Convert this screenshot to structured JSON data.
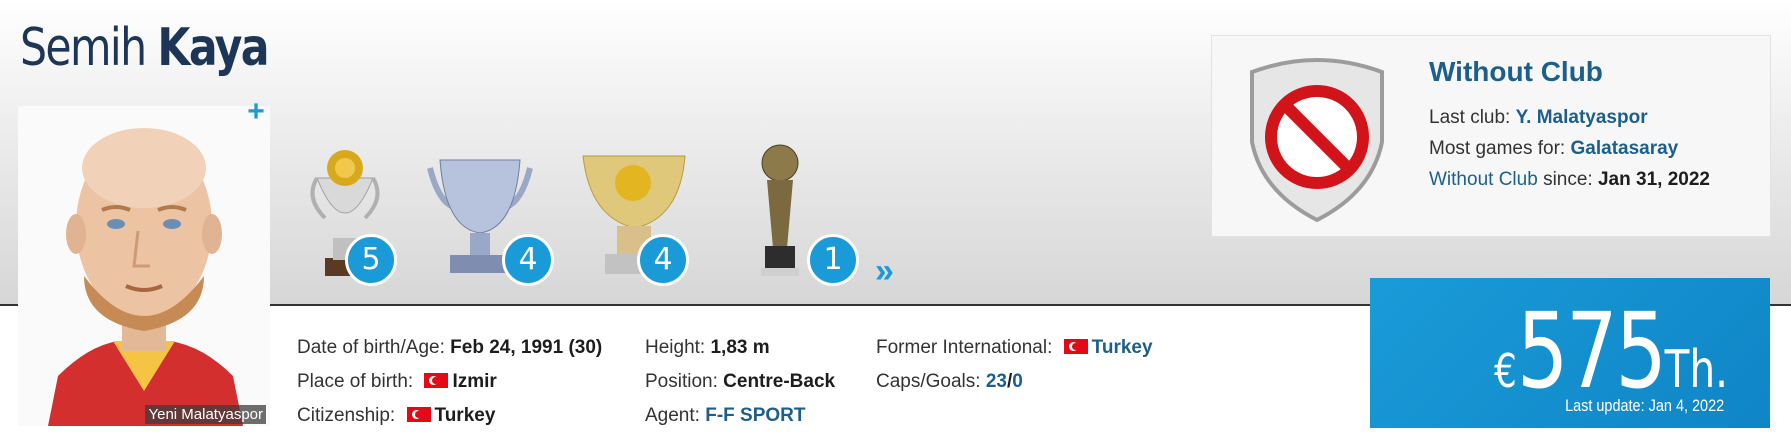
{
  "player": {
    "first_name": "Semih",
    "last_name": "Kaya",
    "photo_caption": "Yeni Malatyaspor",
    "plus_label": "+"
  },
  "trophies": [
    {
      "name": "league-trophy",
      "count": "5"
    },
    {
      "name": "cup-trophy",
      "count": "4"
    },
    {
      "name": "super-cup-trophy",
      "count": "4"
    },
    {
      "name": "ball-trophy",
      "count": "1"
    }
  ],
  "more_trophies": "»",
  "info": {
    "dob_label": "Date of birth/Age:",
    "dob_value": "Feb 24, 1991 (30)",
    "pob_label": "Place of birth:",
    "pob_value": "Izmir",
    "citizenship_label": "Citizenship:",
    "citizenship_value": "Turkey",
    "height_label": "Height:",
    "height_value": "1,83 m",
    "position_label": "Position:",
    "position_value": "Centre-Back",
    "agent_label": "Agent:",
    "agent_value": "F-F SPORT",
    "former_int_label": "Former International:",
    "former_int_value": "Turkey",
    "caps_label": "Caps/Goals:",
    "caps_value": "23",
    "caps_sep": "/",
    "goals_value": "0"
  },
  "club": {
    "title": "Without Club",
    "last_club_label": "Last club:",
    "last_club_value": "Y. Malatyaspor",
    "most_games_label": "Most games for:",
    "most_games_value": "Galatasaray",
    "since_link": "Without Club",
    "since_label": "since:",
    "since_value": "Jan 31, 2022"
  },
  "market_value": {
    "currency": "€",
    "amount": "575",
    "unit": "Th.",
    "last_update": "Last update: Jan 4, 2022"
  },
  "colors": {
    "accent": "#1a9bd8",
    "link": "#1d5f8c",
    "name": "#1d3557"
  }
}
